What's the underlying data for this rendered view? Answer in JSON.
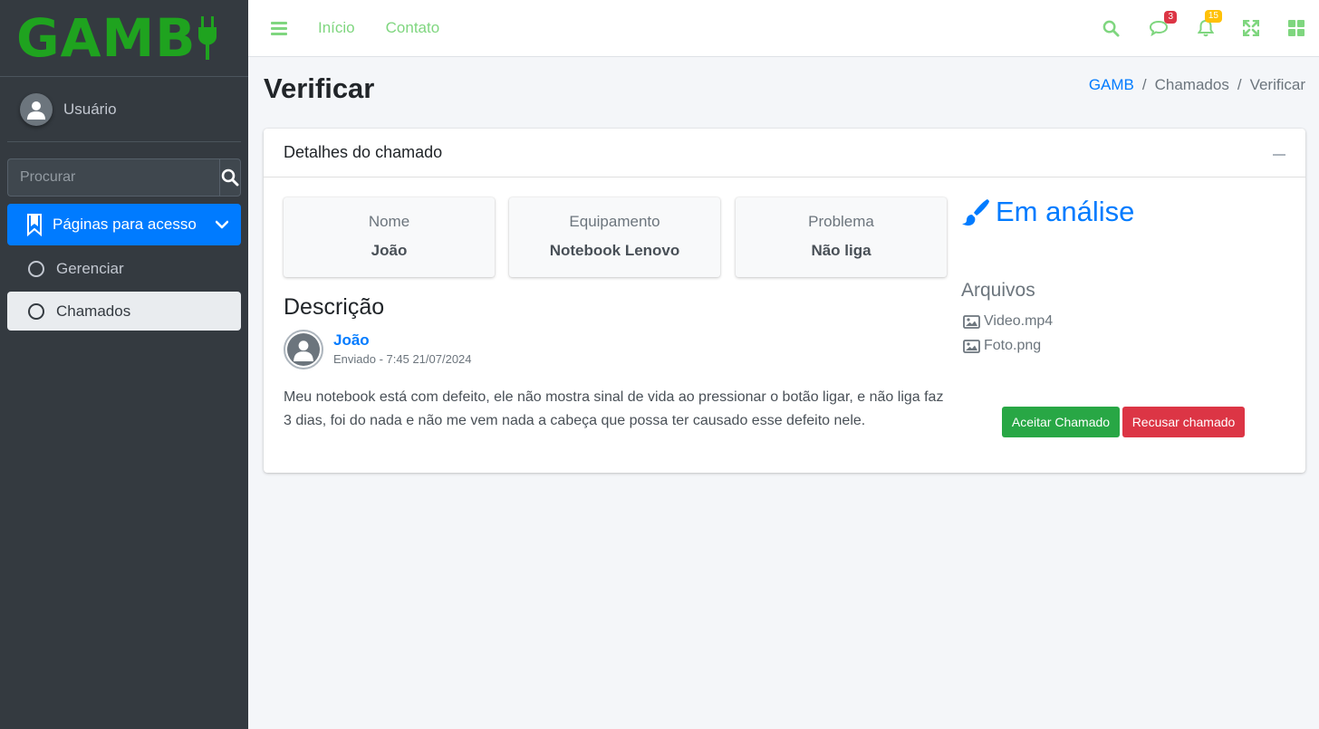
{
  "brand": {
    "name": "GAMB"
  },
  "sidebar": {
    "user_name": "Usuário",
    "search_placeholder": "Procurar",
    "menu_open_label": "Páginas para acesso",
    "items": [
      {
        "label": "Gerenciar"
      },
      {
        "label": "Chamados"
      }
    ]
  },
  "topbar": {
    "links": [
      "Início",
      "Contato"
    ],
    "messages_count": "3",
    "notifications_count": "15"
  },
  "page": {
    "title": "Verificar",
    "breadcrumb": [
      "GAMB",
      "Chamados",
      "Verificar"
    ]
  },
  "card": {
    "title": "Detalhes do chamado",
    "info": [
      {
        "label": "Nome",
        "value": "João"
      },
      {
        "label": "Equipamento",
        "value": "Notebook Lenovo"
      },
      {
        "label": "Problema",
        "value": "Não liga"
      }
    ],
    "description_title": "Descrição",
    "author_name": "João",
    "author_meta": "Enviado - 7:45 21/07/2024",
    "description": "Meu notebook está com defeito, ele não mostra sinal de vida ao pressionar o botão ligar, e não liga faz 3 dias, foi do nada e não me vem nada a cabeça que possa ter causado esse defeito nele.",
    "status": "Em análise",
    "files_title": "Arquivos",
    "files": [
      "Video.mp4",
      "Foto.png"
    ],
    "accept_label": "Aceitar Chamado",
    "reject_label": "Recusar chamado"
  },
  "colors": {
    "primary": "#007bff",
    "success": "#28a745",
    "danger": "#dc3545",
    "sidebar": "#343a40",
    "brand_green": "#1fa31f",
    "topbar_icon": "#7fd67f"
  }
}
